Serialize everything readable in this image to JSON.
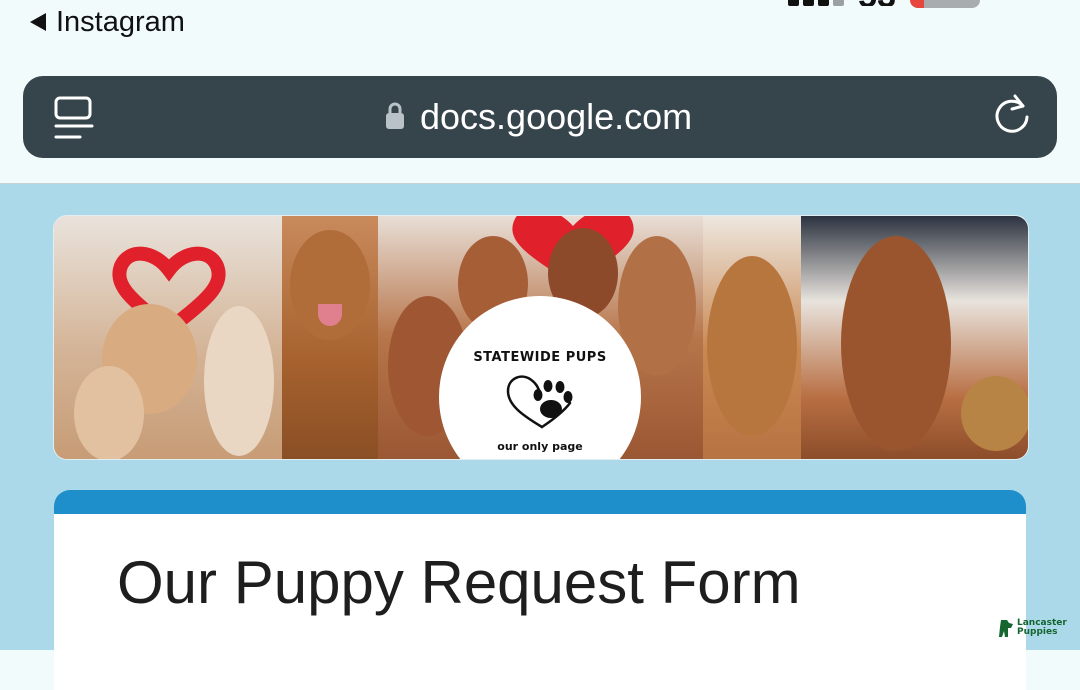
{
  "status_bar": {
    "back_label": "Instagram",
    "time": "53",
    "battery_level": "18"
  },
  "address_bar": {
    "url": "docs.google.com"
  },
  "banner": {
    "brand_name": "STATEWIDE PUPS",
    "tagline": "our only page"
  },
  "form": {
    "title": "Our Puppy Request Form",
    "accent_color": "#1f8fcc"
  },
  "watermark": {
    "line1": "Lancaster",
    "line2": "Puppies"
  },
  "icons": [
    "back-arrow-icon",
    "tabs-icon",
    "lock-icon",
    "reload-icon",
    "heart-paw-icon",
    "signal-icon",
    "battery-icon"
  ]
}
